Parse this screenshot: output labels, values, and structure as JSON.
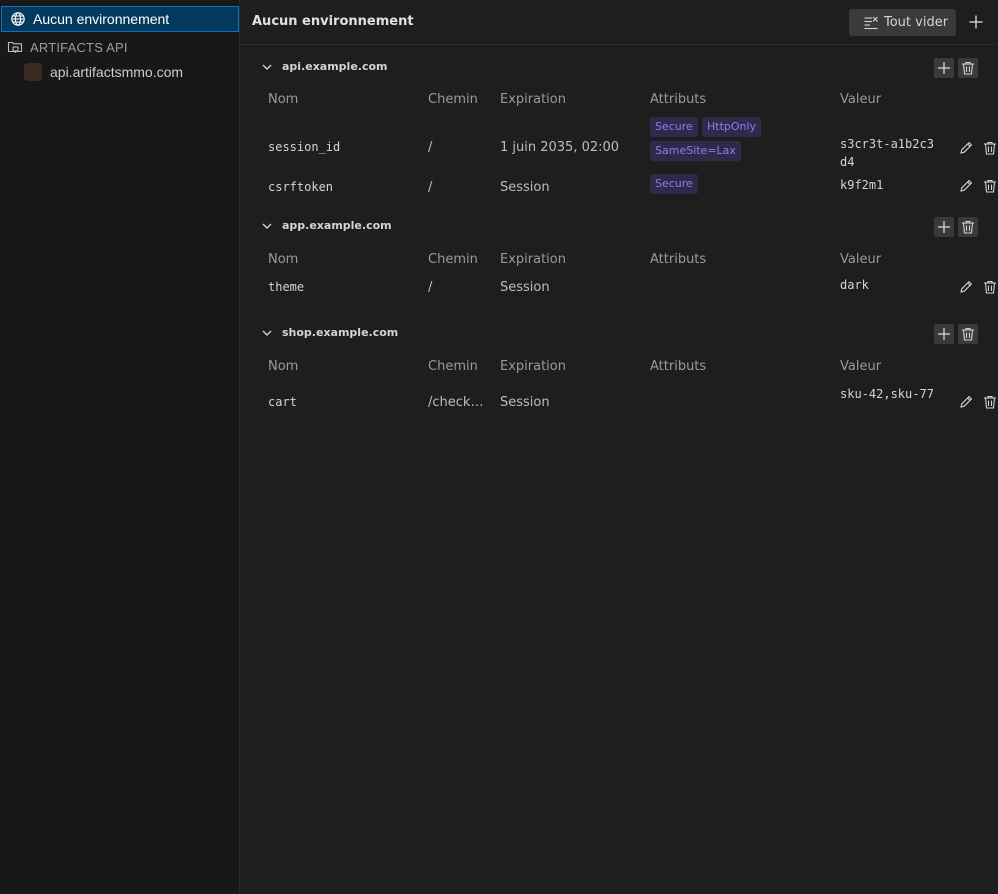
{
  "sidebar": {
    "environment": {
      "label": "Aucun environnement",
      "icon": "globe-icon",
      "selected": true
    },
    "group": {
      "label": "ARTIFACTS API",
      "icon": "folder-network-icon"
    },
    "request": {
      "label": "api.artifactsmmo.com",
      "icon_color": "#3a2a22"
    }
  },
  "header": {
    "title": "Aucun environnement",
    "clear_all_label": "Tout vider",
    "add_icon": "plus-icon"
  },
  "columns": {
    "name": "Nom",
    "path": "Chemin",
    "expiration": "Expiration",
    "attributes": "Attributs",
    "value": "Valeur"
  },
  "domains": [
    {
      "domain": "api.example.com",
      "cookies": [
        {
          "name": "session_id",
          "path": "/",
          "expiration": "1 juin 2035, 02:00",
          "attributes": [
            "Secure",
            "HttpOnly",
            "SameSite=Lax"
          ],
          "value": "s3cr3t-a1b2c3d4"
        },
        {
          "name": "csrftoken",
          "path": "/",
          "expiration": "Session",
          "attributes": [
            "Secure"
          ],
          "value": "k9f2m1"
        }
      ]
    },
    {
      "domain": "app.example.com",
      "cookies": [
        {
          "name": "theme",
          "path": "/",
          "expiration": "Session",
          "attributes": [],
          "value": "dark"
        }
      ]
    },
    {
      "domain": "shop.example.com",
      "cookies": [
        {
          "name": "cart",
          "path": "/check…",
          "expiration": "Session",
          "attributes": [],
          "value": "sku-42,sku-77"
        }
      ]
    }
  ],
  "colors": {
    "accent_selected_bg": "#04395e",
    "accent_selected_border": "#0f6fbf",
    "badge_bg": "#2f2a4a",
    "badge_text": "#8e7cf0"
  }
}
